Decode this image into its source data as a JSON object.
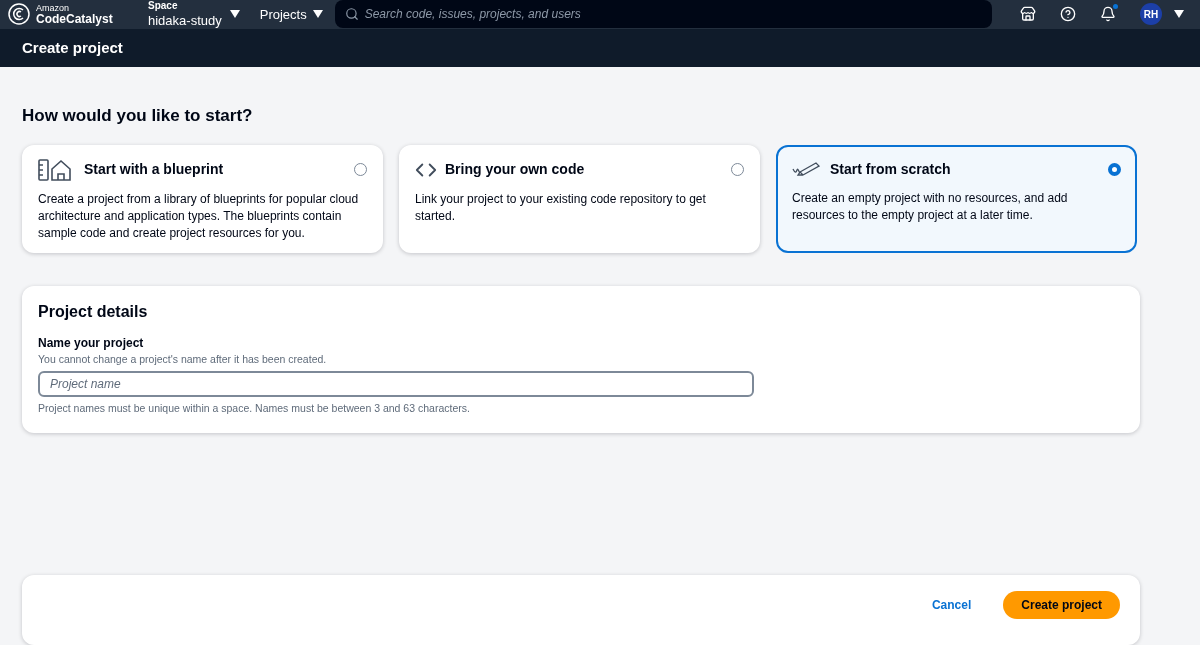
{
  "topbar": {
    "logo_small": "Amazon",
    "logo_name": "CodeCatalyst",
    "space_label": "Space",
    "space_name": "hidaka-study",
    "projects": "Projects",
    "search_placeholder": "Search code, issues, projects, and users",
    "avatar": "RH",
    "notification_dot": true
  },
  "header": {
    "title": "Create project"
  },
  "start": {
    "heading": "How would you like to start?",
    "options": [
      {
        "kind": "blueprint",
        "title": "Start with a blueprint",
        "description": "Create a project from a library of blueprints for popular cloud architecture and application types. The blueprints contain sample code and create project resources for you.",
        "selected": false
      },
      {
        "kind": "code",
        "title": "Bring your own code",
        "description": "Link your project to your existing code repository to get started.",
        "selected": false
      },
      {
        "kind": "scratch",
        "title": "Start from scratch",
        "description": "Create an empty project with no resources, and add resources to the empty project at a later time.",
        "selected": true
      }
    ]
  },
  "details": {
    "title": "Project details",
    "label": "Name your project",
    "description": "You cannot change a project's name after it has been created.",
    "placeholder": "Project name",
    "constraint": "Project names must be unique within a space. Names must be between 3 and 63 characters."
  },
  "footer": {
    "cancel": "Cancel",
    "create": "Create project"
  }
}
